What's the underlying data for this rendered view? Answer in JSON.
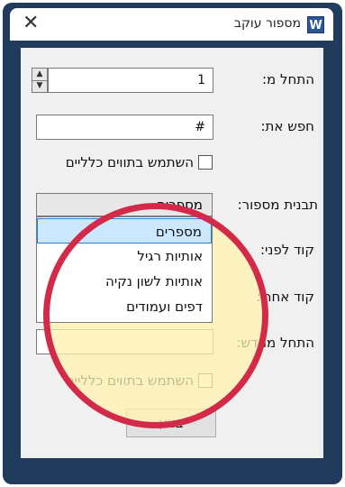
{
  "window": {
    "title": "מספור עוקב",
    "app_icon_letter": "W"
  },
  "form": {
    "start_at_label": "התחל מ:",
    "start_at_value": "1",
    "find_label": "חפש את:",
    "find_value": "#",
    "wildcards_top_label": "השתמש בתווים כלליים",
    "number_format_label": "תבנית מספור:",
    "number_format_selected": "מספרים",
    "number_format_options": [
      "מספרים",
      "אותיות רגיל",
      "אותיות לשון נקיה",
      "דפים ועמודים"
    ],
    "prefix_label": "קוד לפני:",
    "suffix_label": "קוד אחרי:",
    "restart_label": "התחל מחדש:",
    "wildcards_bottom_label": "השתמש בתווים כלליים",
    "execute_button": "בצע"
  },
  "annotation": {
    "circle_color": "#d42a4a",
    "circle_fill": "#fff3b0"
  }
}
